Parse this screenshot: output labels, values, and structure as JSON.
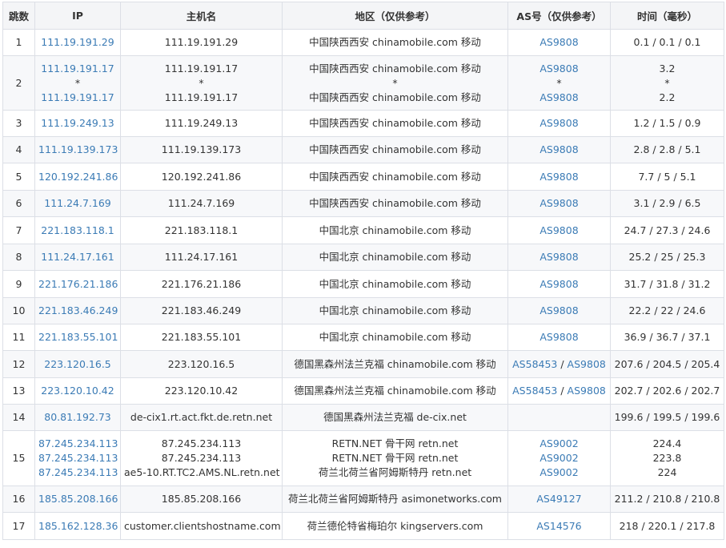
{
  "table": {
    "headers": {
      "hop": "跳数",
      "ip": "IP",
      "hostname": "主机名",
      "region": "地区（仅供参考）",
      "as": "AS号（仅供参考）",
      "time": "时间（毫秒）"
    },
    "rows": [
      {
        "hop": "1",
        "ip": [
          "111.19.191.29"
        ],
        "host": [
          "111.19.191.29"
        ],
        "region": [
          "中国陕西西安 chinamobile.com 移动"
        ],
        "as": [
          [
            "AS9808"
          ]
        ],
        "time": [
          "0.1 / 0.1 / 0.1"
        ]
      },
      {
        "hop": "2",
        "ip": [
          "111.19.191.17",
          "*",
          "111.19.191.17"
        ],
        "host": [
          "111.19.191.17",
          "*",
          "111.19.191.17"
        ],
        "region": [
          "中国陕西西安 chinamobile.com 移动",
          "*",
          "中国陕西西安 chinamobile.com 移动"
        ],
        "as": [
          [
            "AS9808"
          ],
          [
            "*"
          ],
          [
            "AS9808"
          ]
        ],
        "time": [
          "3.2",
          "*",
          "2.2"
        ]
      },
      {
        "hop": "3",
        "ip": [
          "111.19.249.13"
        ],
        "host": [
          "111.19.249.13"
        ],
        "region": [
          "中国陕西西安 chinamobile.com 移动"
        ],
        "as": [
          [
            "AS9808"
          ]
        ],
        "time": [
          "1.2 / 1.5 / 0.9"
        ]
      },
      {
        "hop": "4",
        "ip": [
          "111.19.139.173"
        ],
        "host": [
          "111.19.139.173"
        ],
        "region": [
          "中国陕西西安 chinamobile.com 移动"
        ],
        "as": [
          [
            "AS9808"
          ]
        ],
        "time": [
          "2.8 / 2.8 / 5.1"
        ]
      },
      {
        "hop": "5",
        "ip": [
          "120.192.241.86"
        ],
        "host": [
          "120.192.241.86"
        ],
        "region": [
          "中国陕西西安 chinamobile.com 移动"
        ],
        "as": [
          [
            "AS9808"
          ]
        ],
        "time": [
          "7.7 / 5 / 5.1"
        ]
      },
      {
        "hop": "6",
        "ip": [
          "111.24.7.169"
        ],
        "host": [
          "111.24.7.169"
        ],
        "region": [
          "中国陕西西安 chinamobile.com 移动"
        ],
        "as": [
          [
            "AS9808"
          ]
        ],
        "time": [
          "3.1 / 2.9 / 6.5"
        ]
      },
      {
        "hop": "7",
        "ip": [
          "221.183.118.1"
        ],
        "host": [
          "221.183.118.1"
        ],
        "region": [
          "中国北京 chinamobile.com 移动"
        ],
        "as": [
          [
            "AS9808"
          ]
        ],
        "time": [
          "24.7 / 27.3 / 24.6"
        ]
      },
      {
        "hop": "8",
        "ip": [
          "111.24.17.161"
        ],
        "host": [
          "111.24.17.161"
        ],
        "region": [
          "中国北京 chinamobile.com 移动"
        ],
        "as": [
          [
            "AS9808"
          ]
        ],
        "time": [
          "25.2 / 25 / 25.3"
        ]
      },
      {
        "hop": "9",
        "ip": [
          "221.176.21.186"
        ],
        "host": [
          "221.176.21.186"
        ],
        "region": [
          "中国北京 chinamobile.com 移动"
        ],
        "as": [
          [
            "AS9808"
          ]
        ],
        "time": [
          "31.7 / 31.8 / 31.2"
        ]
      },
      {
        "hop": "10",
        "ip": [
          "221.183.46.249"
        ],
        "host": [
          "221.183.46.249"
        ],
        "region": [
          "中国北京 chinamobile.com 移动"
        ],
        "as": [
          [
            "AS9808"
          ]
        ],
        "time": [
          "22.2 / 22 / 24.6"
        ]
      },
      {
        "hop": "11",
        "ip": [
          "221.183.55.101"
        ],
        "host": [
          "221.183.55.101"
        ],
        "region": [
          "中国北京 chinamobile.com 移动"
        ],
        "as": [
          [
            "AS9808"
          ]
        ],
        "time": [
          "36.9 / 36.7 / 37.1"
        ]
      },
      {
        "hop": "12",
        "ip": [
          "223.120.16.5"
        ],
        "host": [
          "223.120.16.5"
        ],
        "region": [
          "德国黑森州法兰克福 chinamobile.com 移动"
        ],
        "as": [
          [
            "AS58453",
            "AS9808"
          ]
        ],
        "time": [
          "207.6 / 204.5 / 205.4"
        ]
      },
      {
        "hop": "13",
        "ip": [
          "223.120.10.42"
        ],
        "host": [
          "223.120.10.42"
        ],
        "region": [
          "德国黑森州法兰克福 chinamobile.com 移动"
        ],
        "as": [
          [
            "AS58453",
            "AS9808"
          ]
        ],
        "time": [
          "202.7 / 202.6 / 202.7"
        ]
      },
      {
        "hop": "14",
        "ip": [
          "80.81.192.73"
        ],
        "host": [
          "de-cix1.rt.act.fkt.de.retn.net"
        ],
        "region": [
          "德国黑森州法兰克福 de-cix.net"
        ],
        "as": [
          []
        ],
        "time": [
          "199.6 / 199.5 / 199.6"
        ]
      },
      {
        "hop": "15",
        "ip": [
          "87.245.234.113",
          "87.245.234.113",
          "87.245.234.113"
        ],
        "host": [
          "87.245.234.113",
          "87.245.234.113",
          "ae5-10.RT.TC2.AMS.NL.retn.net"
        ],
        "region": [
          "RETN.NET 骨干网 retn.net",
          "RETN.NET 骨干网 retn.net",
          "荷兰北荷兰省阿姆斯特丹 retn.net"
        ],
        "as": [
          [
            "AS9002"
          ],
          [
            "AS9002"
          ],
          [
            "AS9002"
          ]
        ],
        "time": [
          "224.4",
          "223.8",
          "224"
        ]
      },
      {
        "hop": "16",
        "ip": [
          "185.85.208.166"
        ],
        "host": [
          "185.85.208.166"
        ],
        "region": [
          "荷兰北荷兰省阿姆斯特丹 asimonetworks.com"
        ],
        "as": [
          [
            "AS49127"
          ]
        ],
        "time": [
          "211.2 / 210.8 / 210.8"
        ]
      },
      {
        "hop": "17",
        "ip": [
          "185.162.128.36"
        ],
        "host": [
          "customer.clientshostname.com"
        ],
        "region": [
          "荷兰德伦特省梅珀尔 kingservers.com"
        ],
        "as": [
          [
            "AS14576"
          ]
        ],
        "time": [
          "218 / 220.1 / 217.8"
        ]
      }
    ],
    "as_separator": " / ",
    "colors": {
      "link": "#3b7bb5",
      "border": "#dcdfe6",
      "header_bg": "#f4f5f7",
      "stripe_bg": "#f7f8fa",
      "text": "#333333"
    }
  }
}
